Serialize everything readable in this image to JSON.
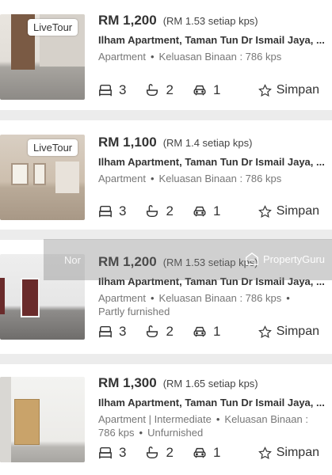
{
  "listings": [
    {
      "badge": "LiveTour",
      "price": "RM 1,200",
      "psf": "(RM 1.53 setiap kps)",
      "title": "Ilham Apartment, Taman Tun Dr Ismail Jaya, ...",
      "meta_line1": [
        "Apartment",
        "Keluasan Binaan : 786 kps"
      ],
      "meta_line2": "",
      "beds": "3",
      "baths": "2",
      "parking": "1",
      "save_label": "Simpan"
    },
    {
      "badge": "LiveTour",
      "price": "RM 1,100",
      "psf": "(RM 1.4 setiap kps)",
      "title": "Ilham Apartment, Taman Tun Dr Ismail Jaya, ...",
      "meta_line1": [
        "Apartment",
        "Keluasan Binaan : 786 kps"
      ],
      "meta_line2": "",
      "beds": "3",
      "baths": "2",
      "parking": "1",
      "save_label": "Simpan"
    },
    {
      "badge": "",
      "price": "RM 1,200",
      "psf": "(RM 1.53 setiap kps)",
      "title": "Ilham Apartment, Taman Tun Dr Ismail Jaya, ...",
      "meta_line1": [
        "Apartment",
        "Keluasan Binaan : 786 kps"
      ],
      "meta_line2": "Partly furnished",
      "beds": "3",
      "baths": "2",
      "parking": "1",
      "save_label": "Simpan"
    },
    {
      "badge": "",
      "price": "RM 1,300",
      "psf": "(RM 1.65 setiap kps)",
      "title": "Ilham Apartment, Taman Tun Dr Ismail Jaya, ...",
      "meta_line1": [
        "Apartment | Intermediate",
        "Keluasan Binaan :"
      ],
      "meta_line2": "786 kps",
      "meta_line2b": "Unfurnished",
      "beds": "3",
      "baths": "2",
      "parking": "1",
      "save_label": "Simpan"
    }
  ],
  "overlay": {
    "left_text": "Nor",
    "watermark": "PropertyGuru"
  }
}
